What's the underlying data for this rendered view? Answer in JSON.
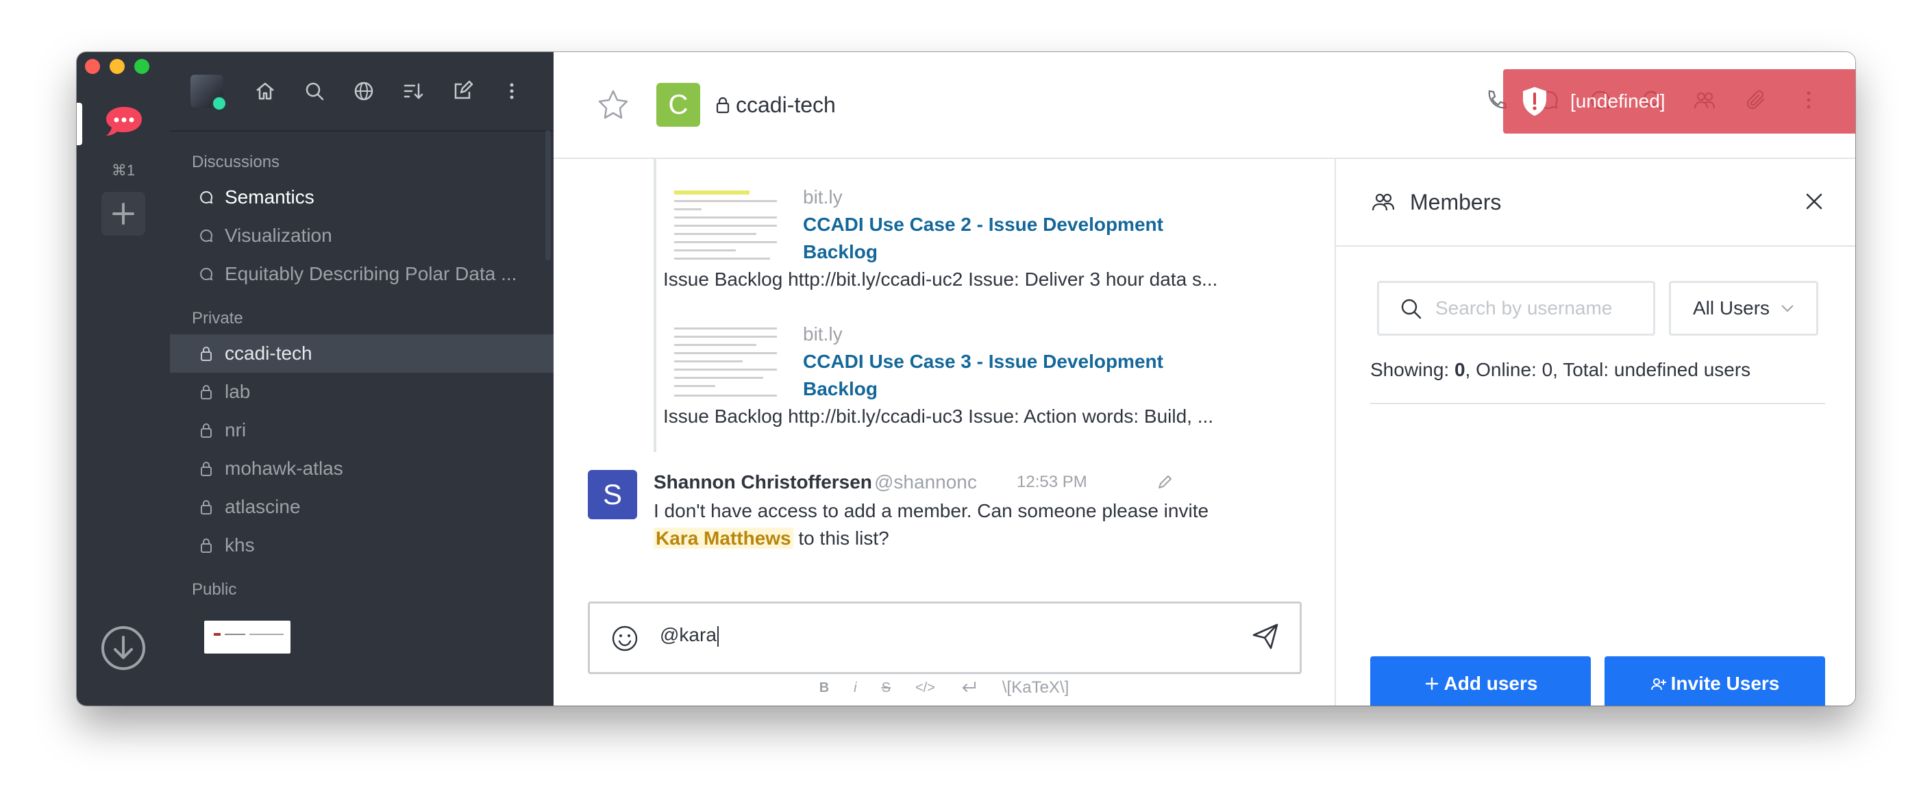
{
  "rail": {
    "shortcut": "⌘1"
  },
  "sidebar": {
    "sections": {
      "discussions": "Discussions",
      "private": "Private",
      "public": "Public"
    },
    "discussions": [
      {
        "label": "Semantics"
      },
      {
        "label": "Visualization"
      },
      {
        "label": "Equitably Describing Polar Data ..."
      }
    ],
    "private": [
      {
        "label": "ccadi-tech"
      },
      {
        "label": "lab"
      },
      {
        "label": "nri"
      },
      {
        "label": "mohawk-atlas"
      },
      {
        "label": "atlascine"
      },
      {
        "label": "khs"
      }
    ]
  },
  "room": {
    "avatar_letter": "C",
    "name": "ccadi-tech",
    "avatar_color": "#8bc34a"
  },
  "toast": {
    "message": "[undefined]"
  },
  "messages": {
    "links": [
      {
        "site": "bit.ly",
        "title_line1": "CCADI Use Case 2 - Issue Development",
        "title_line2": "Backlog",
        "text": "Issue Backlog http://bit.ly/ccadi-uc2 Issue: Deliver 3 hour data s..."
      },
      {
        "site": "bit.ly",
        "title_line1": "CCADI Use Case 3 - Issue Development",
        "title_line2": "Backlog",
        "text": "Issue Backlog http://bit.ly/ccadi-uc3 Issue: Action words: Build, ..."
      }
    ],
    "post": {
      "avatar_letter": "S",
      "author": "Shannon Christoffersen",
      "username": "@shannonc",
      "time": "12:53 PM",
      "body_part1": "I don't have access to add a member. Can someone please invite",
      "mention": "Kara Matthews",
      "body_part2": "to this list?"
    }
  },
  "composer": {
    "value": "@kara"
  },
  "formatting": {
    "bold": "B",
    "italic": "i",
    "strike": "S",
    "code": "</>",
    "katex": "\\[KaTeX\\]"
  },
  "members": {
    "title": "Members",
    "search_placeholder": "Search by username",
    "filter": "All Users",
    "showing_label": "Showing: ",
    "showing_value": "0",
    "online_text": ", Online: 0, Total: undefined users",
    "add_users": "Add users",
    "invite_users": "Invite Users"
  },
  "colors": {
    "accent": "#1d74f5",
    "sidebar_bg": "#2f343d",
    "toast_bg": "#d8404c",
    "brand_red": "#f5455c"
  }
}
